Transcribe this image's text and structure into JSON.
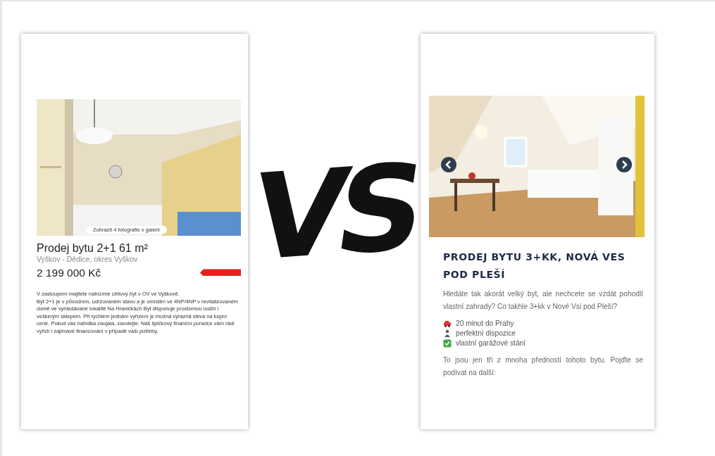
{
  "left_listing": {
    "gallery_button": "Zobrazit 4 fotografie v galerii",
    "title": "Prodej bytu 2+1 61 m²",
    "location": "Vyškov - Dědice, okres Vyškov",
    "price": "2 199 000 Kč",
    "description": [
      "V zastoupení majitele nabízíme cihlový byt v OV ve Vyškově.",
      "Byt 2+1 je v původním, udržovaném stavu a je umístěn ve 4NP/4NP v revitalizovaném domě ve vyhledávané lokalitě Na Hraničkách Byt disponuje prostornou lodžií i veškerým sklepem. Při rychlém jednání vyřízení je možná výrazná sleva na kupní ceně. Pokud vás nabídka zaujala, zavolejte. Náš špičkový finanční poradce vám rádi vyřídí i zajímavé financování v případě vaší potřeby."
    ]
  },
  "vs_mark": "VS",
  "right_listing": {
    "title": "PRODEJ BYTU 3+KK, NOVÁ VES POD PLEŠÍ",
    "intro": "Hledáte tak akorát velký byt, ale nechcete se vzdát pohodlí vlastní zahrady? Co takhle 3+kk v Nové Vsi pod Pleší?",
    "features": [
      {
        "kind": "car",
        "text": "20 minut do Prahy"
      },
      {
        "kind": "person",
        "text": "perfektní dispozice"
      },
      {
        "kind": "check",
        "text": "vlastní garážové stání"
      }
    ],
    "outro": "To jsou jen tři z mnoha předností tohoto bytu. Pojďte se podívat na další:"
  }
}
